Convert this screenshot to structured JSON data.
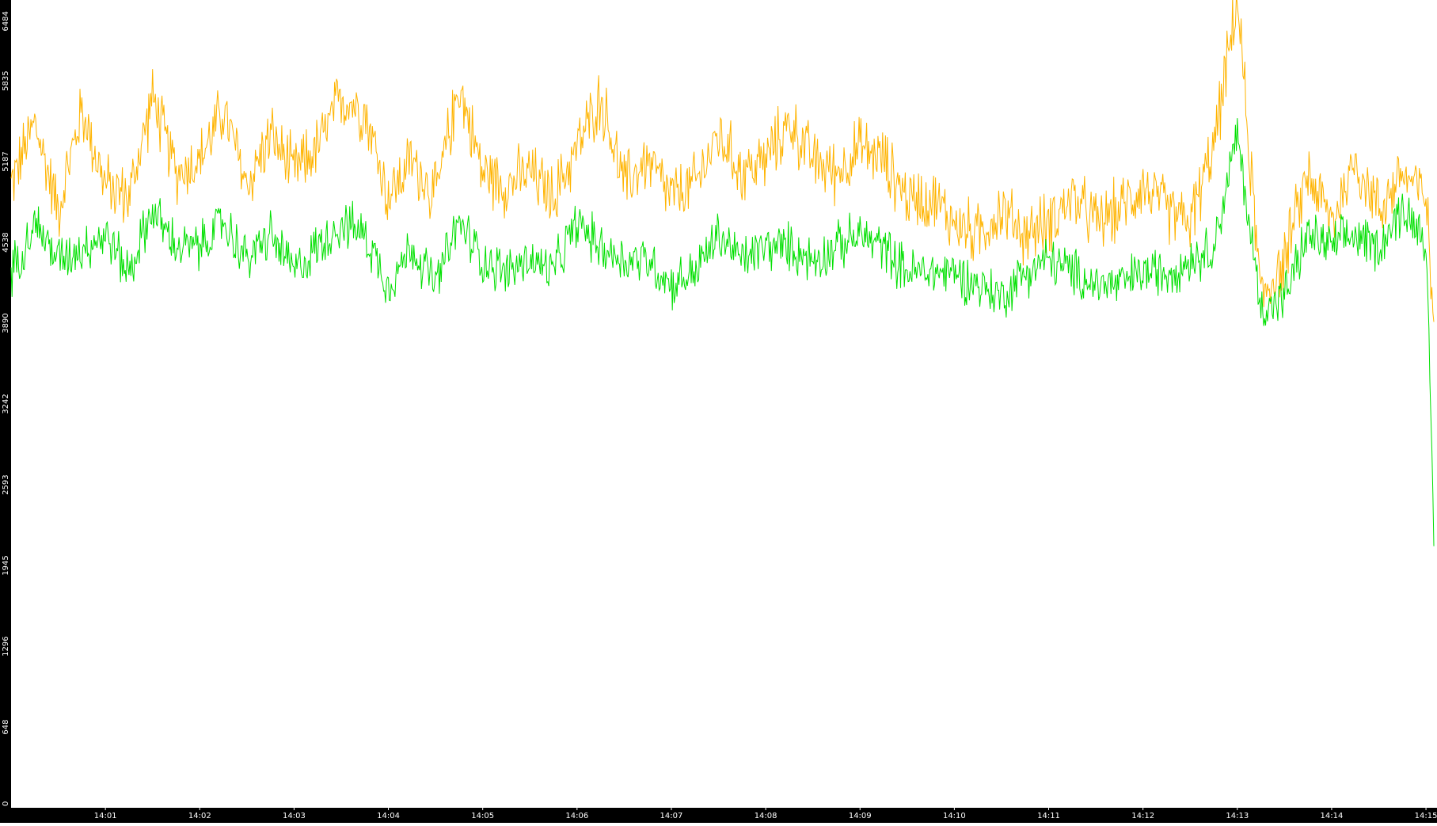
{
  "colors": {
    "background": "#ffffff",
    "axis_bar": "#000000",
    "axis_text": "#ffffff",
    "series_orange": "#ffb400",
    "series_green": "#00e000"
  },
  "chart_data": {
    "type": "line",
    "title": "",
    "xlabel": "",
    "ylabel": "",
    "grid": false,
    "legend": "none",
    "ylim": [
      0,
      6484
    ],
    "xlim": [
      "14:00:00",
      "14:15:05"
    ],
    "yticks": [
      0,
      648,
      1296,
      1945,
      2593,
      3242,
      3890,
      4538,
      5187,
      5835,
      6484
    ],
    "xticks": [
      "14:01",
      "14:02",
      "14:03",
      "14:04",
      "14:05",
      "14:06",
      "14:07",
      "14:08",
      "14:09",
      "14:10",
      "14:11",
      "14:12",
      "14:13",
      "14:14",
      "14:15"
    ],
    "x": [
      "14:00:00",
      "14:00:15",
      "14:00:30",
      "14:00:45",
      "14:01:00",
      "14:01:15",
      "14:01:30",
      "14:01:45",
      "14:02:00",
      "14:02:15",
      "14:02:30",
      "14:02:45",
      "14:03:00",
      "14:03:15",
      "14:03:30",
      "14:03:45",
      "14:04:00",
      "14:04:15",
      "14:04:30",
      "14:04:45",
      "14:05:00",
      "14:05:15",
      "14:05:30",
      "14:05:45",
      "14:06:00",
      "14:06:15",
      "14:06:30",
      "14:06:45",
      "14:07:00",
      "14:07:15",
      "14:07:30",
      "14:07:45",
      "14:08:00",
      "14:08:15",
      "14:08:30",
      "14:08:45",
      "14:09:00",
      "14:09:15",
      "14:09:30",
      "14:09:45",
      "14:10:00",
      "14:10:15",
      "14:10:30",
      "14:10:45",
      "14:11:00",
      "14:11:15",
      "14:11:30",
      "14:11:45",
      "14:12:00",
      "14:12:15",
      "14:12:30",
      "14:12:45",
      "14:13:00",
      "14:13:15",
      "14:13:30",
      "14:13:45",
      "14:14:00",
      "14:14:15",
      "14:14:30",
      "14:14:45",
      "14:15:00",
      "14:15:05"
    ],
    "series": [
      {
        "color": "#ffb400",
        "values": [
          5000,
          5500,
          4800,
          5600,
          5000,
          4900,
          5700,
          5100,
          5200,
          5600,
          5000,
          5400,
          5100,
          5300,
          5700,
          5600,
          4900,
          5200,
          4900,
          5800,
          5100,
          5000,
          5100,
          4900,
          5300,
          5700,
          5000,
          5200,
          4900,
          5000,
          5400,
          5100,
          5200,
          5500,
          5200,
          5100,
          5300,
          5200,
          4900,
          4900,
          4700,
          4600,
          4800,
          4600,
          4700,
          4900,
          4700,
          4800,
          5000,
          4800,
          4700,
          5300,
          6484,
          4100,
          4400,
          5100,
          4700,
          5200,
          4800,
          5100,
          4900,
          3900
        ]
      },
      {
        "color": "#00e000",
        "values": [
          4300,
          4700,
          4400,
          4500,
          4600,
          4300,
          4800,
          4500,
          4500,
          4700,
          4400,
          4600,
          4300,
          4500,
          4700,
          4600,
          4200,
          4500,
          4200,
          4700,
          4400,
          4300,
          4400,
          4300,
          4700,
          4500,
          4400,
          4400,
          4200,
          4300,
          4600,
          4400,
          4500,
          4500,
          4400,
          4500,
          4600,
          4500,
          4300,
          4300,
          4300,
          4200,
          4100,
          4300,
          4400,
          4300,
          4200,
          4200,
          4300,
          4300,
          4400,
          4500,
          5400,
          4000,
          4100,
          4600,
          4500,
          4600,
          4500,
          4800,
          4600,
          2100
        ]
      }
    ]
  }
}
